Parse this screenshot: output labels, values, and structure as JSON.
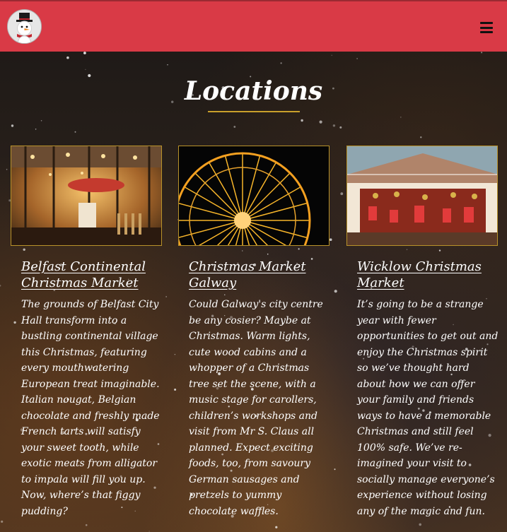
{
  "header": {
    "logo_alt": "snowman",
    "menu_icon": "hamburger-menu-icon",
    "background_color": "#d93a46"
  },
  "section": {
    "title": "Locations",
    "accent_color": "#c9a02b"
  },
  "locations": [
    {
      "title": "Belfast Continental Christmas Market",
      "image": "carousel-photo",
      "text": "The grounds of Belfast City Hall transform into a bustling continental village this Christmas, featuring every mouthwatering European treat imaginable. Italian nougat, Belgian chocolate and freshly made French tarts will satisfy your sweet tooth, while exotic meats from alligator to impala will fill you up. Now, where’s that figgy pudding?"
    },
    {
      "title": "Christmas Market Galway",
      "image": "ferris-wheel-photo",
      "text": "Could Galway's city centre be any cosier? Maybe at Christmas. Warm lights, cute wood cabins and a whopper of a Christmas tree set the scene, with a music stage for carollers, children’s workshops and visit from Mr S. Claus all planned. Expect exciting foods, too, from savoury German sausages and pretzels to yummy chocolate waffles."
    },
    {
      "title": "Wicklow Christmas Market",
      "image": "market-stall-photo",
      "text": "It’s going to be a strange year with fewer opportunities to get out and enjoy the Christmas spirit so we’ve thought hard about how we can offer your family and friends ways to have a memorable Christmas and still feel 100% safe. We’ve re-imagined your visit to socially manage everyone’s experience without losing any of the magic and fun."
    }
  ]
}
